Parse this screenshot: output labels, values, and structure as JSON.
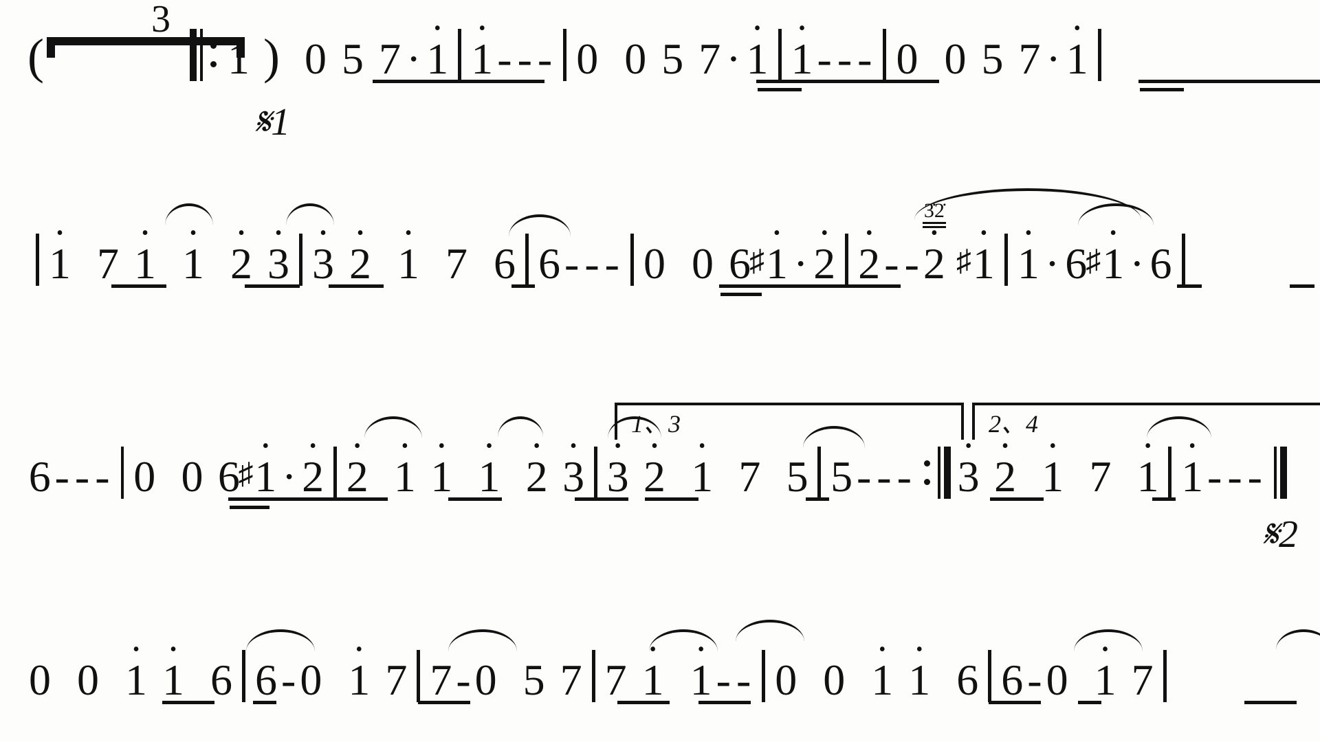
{
  "tuplet_number": "3",
  "segno1": "𝄋1",
  "segno2": "𝄋2",
  "volta1": "1、3",
  "volta2": "2、4",
  "sup32": "3̇2̇",
  "line1": {
    "open": "(",
    "pickup": "1",
    "close": ")",
    "bar1": [
      "0",
      "5",
      "7",
      "·",
      "1̇"
    ],
    "bar2": [
      "1̇",
      "-",
      "-",
      "-"
    ],
    "bar3": [
      "0",
      "0",
      "5",
      "7",
      "·",
      "1̇"
    ],
    "bar4": [
      "1̇",
      "-",
      "-",
      "-"
    ],
    "bar5": [
      "0",
      "0",
      "5",
      "7",
      "·",
      "1̇"
    ]
  },
  "line2": {
    "b1": [
      "1̇",
      "7",
      "1̇",
      "1̇",
      "2̇",
      "3̇"
    ],
    "b2": [
      "3̇",
      "2̇",
      "1̇",
      "7",
      "6"
    ],
    "b3": [
      "6",
      "-",
      "-",
      "-"
    ],
    "b4": [
      "0",
      "0",
      "6",
      "1̇",
      "·",
      "2̇"
    ],
    "b5": [
      "2̇",
      "-",
      "-",
      "2̇",
      "1̇"
    ],
    "b6": [
      "1̇",
      "·",
      "6",
      "1̇",
      "·",
      "6"
    ]
  },
  "line3": {
    "b1": [
      "6",
      "-",
      "-",
      "-"
    ],
    "b2": [
      "0",
      "0",
      "6",
      "1̇",
      "·",
      "2̇"
    ],
    "b3": [
      "2̇",
      "1̇",
      "1̇",
      "1̇",
      "2̇",
      "3̇"
    ],
    "b4": [
      "3̇",
      "2̇",
      "1̇",
      "7",
      "5"
    ],
    "b5": [
      "5",
      "-",
      "-",
      "-"
    ],
    "b6": [
      "3̇",
      "2̇",
      "1̇",
      "7",
      "1̇"
    ],
    "b7": [
      "1̇",
      "-",
      "-",
      "-"
    ]
  },
  "line4": {
    "b1": [
      "0",
      "0",
      "1̇",
      "1̇",
      "6"
    ],
    "b2": [
      "6",
      "-",
      "0",
      "1̇",
      "7"
    ],
    "b3": [
      "7",
      "-",
      "0",
      "5",
      "7"
    ],
    "b4": [
      "7",
      "1̇",
      "1̇",
      "-",
      "-"
    ],
    "b5": [
      "0",
      "0",
      "1̇",
      "1̇",
      "6"
    ],
    "b6": [
      "6",
      "-",
      "0",
      "1̇",
      "7"
    ]
  }
}
